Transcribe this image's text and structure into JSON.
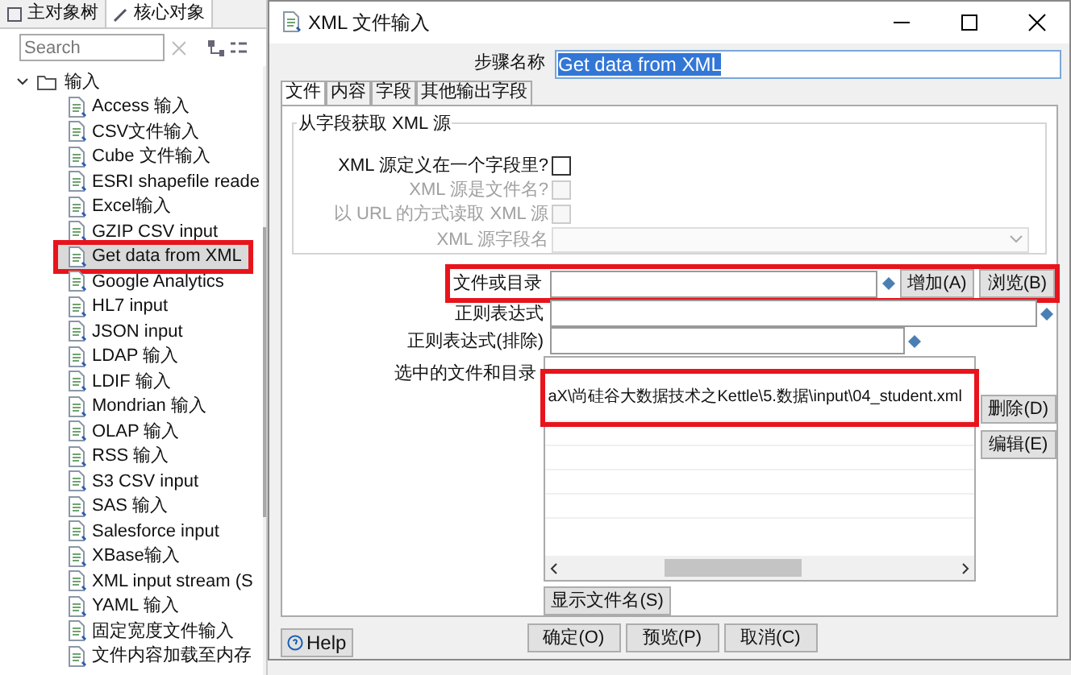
{
  "left_panel": {
    "tabs": [
      {
        "label": "主对象树",
        "selected": false
      },
      {
        "label": "核心对象",
        "selected": true
      }
    ],
    "search": {
      "placeholder": "Search"
    },
    "tree": [
      {
        "label": "输入",
        "expanded": true,
        "children": [
          {
            "label": "Access 输入",
            "selected": false,
            "highlighted": false
          },
          {
            "label": "CSV文件输入",
            "selected": false,
            "highlighted": false
          },
          {
            "label": "Cube 文件输入",
            "selected": false,
            "highlighted": false
          },
          {
            "label": "ESRI shapefile reade",
            "selected": false,
            "highlighted": false
          },
          {
            "label": "Excel输入",
            "selected": false,
            "highlighted": false
          },
          {
            "label": "GZIP CSV input",
            "selected": false,
            "highlighted": false
          },
          {
            "label": "Get data from XML",
            "selected": true,
            "highlighted": true
          },
          {
            "label": "Google Analytics",
            "selected": false,
            "highlighted": false
          },
          {
            "label": "HL7 input",
            "selected": false,
            "highlighted": false
          },
          {
            "label": "JSON input",
            "selected": false,
            "highlighted": false
          },
          {
            "label": "LDAP 输入",
            "selected": false,
            "highlighted": false
          },
          {
            "label": "LDIF 输入",
            "selected": false,
            "highlighted": false
          },
          {
            "label": "Mondrian 输入",
            "selected": false,
            "highlighted": false
          },
          {
            "label": "OLAP 输入",
            "selected": false,
            "highlighted": false
          },
          {
            "label": "RSS 输入",
            "selected": false,
            "highlighted": false
          },
          {
            "label": "S3 CSV input",
            "selected": false,
            "highlighted": false
          },
          {
            "label": "SAS 输入",
            "selected": false,
            "highlighted": false
          },
          {
            "label": "Salesforce input",
            "selected": false,
            "highlighted": false
          },
          {
            "label": "XBase输入",
            "selected": false,
            "highlighted": false
          },
          {
            "label": "XML input stream (S",
            "selected": false,
            "highlighted": false
          },
          {
            "label": "YAML 输入",
            "selected": false,
            "highlighted": false
          },
          {
            "label": "固定宽度文件输入",
            "selected": false,
            "highlighted": false
          },
          {
            "label": "文件内容加载至内存",
            "selected": false,
            "highlighted": false
          }
        ]
      }
    ]
  },
  "dialog": {
    "title": "XML 文件输入",
    "step_name": {
      "label": "步骤名称",
      "value": "Get data from XML"
    },
    "tabs": [
      {
        "label": "文件",
        "selected": true
      },
      {
        "label": "内容",
        "selected": false
      },
      {
        "label": "字段",
        "selected": false
      },
      {
        "label": "其他输出字段",
        "selected": false
      }
    ],
    "source_group": {
      "title": "从字段获取 XML 源",
      "options": [
        {
          "label": "XML 源定义在一个字段里?",
          "checked": false,
          "disabled": false
        },
        {
          "label": "XML 源是文件名?",
          "checked": false,
          "disabled": true
        },
        {
          "label": "以 URL 的方式读取 XML 源",
          "checked": false,
          "disabled": true
        }
      ],
      "field_name": {
        "label": "XML 源字段名",
        "disabled": true
      }
    },
    "file_or_dir": {
      "label": "文件或目录",
      "highlighted": true,
      "buttons": [
        "增加(A)",
        "浏览(B)"
      ]
    },
    "regex": {
      "label": "正则表达式"
    },
    "regex_exclude": {
      "label": "正则表达式(排除)"
    },
    "selected_files": {
      "label": "选中的文件和目录",
      "rows": [
        {
          "column_1": "aX\\尚硅谷大数据技术之Kettle\\5.数据\\input\\04_student.xml",
          "highlighted": true
        }
      ],
      "buttons": [
        "删除(D)",
        "编辑(E)"
      ]
    },
    "show_filenames": "显示文件名(S)",
    "buttons": [
      "确定(O)",
      "预览(P)",
      "取消(C)"
    ],
    "help": "Help"
  }
}
